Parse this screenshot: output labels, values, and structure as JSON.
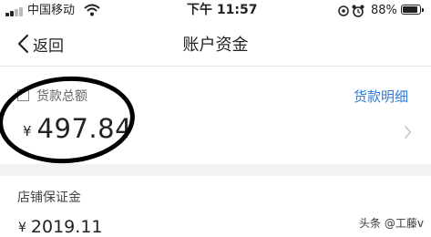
{
  "status_bar": {
    "carrier": "中国移动",
    "time": "下午 11:57",
    "battery": "88%",
    "battery_level": 0.88
  },
  "nav": {
    "back_label": "返回",
    "title": "账户资金"
  },
  "loan": {
    "label": "货款总额",
    "detail_link": "货款明细",
    "currency": "¥",
    "amount": "497.84"
  },
  "deposit": {
    "label": "店铺保证金",
    "currency": "¥",
    "amount": "2019.11"
  },
  "watermark": "头条 @工藤v",
  "icons": {
    "back": "chevron-left-icon",
    "row_arrow": "chevron-right-icon",
    "wifi": "wifi-icon",
    "checkbox": "checkbox-icon"
  },
  "colors": {
    "link": "#2a7de1",
    "annotation_circle": "#000000",
    "section_gap": "#f2f2f2"
  }
}
